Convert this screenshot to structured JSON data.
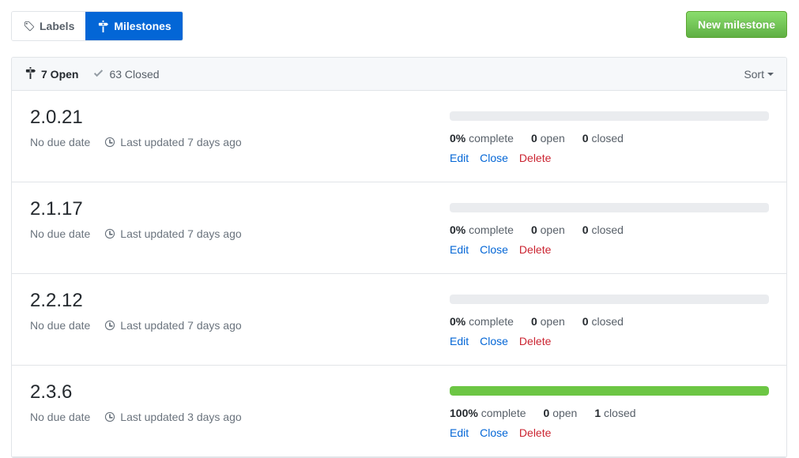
{
  "tabs": [
    {
      "label": "Labels",
      "icon": "tag-icon",
      "active": false
    },
    {
      "label": "Milestones",
      "icon": "milestone-icon",
      "active": true
    }
  ],
  "new_milestone_button": "New milestone",
  "list_header": {
    "open_state": "7 Open",
    "closed_state": "63 Closed",
    "open_icon": "milestone-icon",
    "closed_icon": "check-icon",
    "sort_label": "Sort"
  },
  "action_labels": {
    "edit": "Edit",
    "close": "Close",
    "delete": "Delete"
  },
  "stat_labels": {
    "complete": "complete",
    "open": "open",
    "closed": "closed"
  },
  "colors": {
    "accent_blue": "#0366d6",
    "progress_green": "#6cc644",
    "button_green": "#60b044",
    "delete_red": "#cb2431",
    "progress_track": "#eaecef",
    "border": "#e1e4e8",
    "header_bg": "#f6f8fa"
  },
  "milestones": [
    {
      "title": "2.0.21",
      "due": "No due date",
      "updated": "Last updated 7 days ago",
      "percent_label": "0%",
      "percent_value": 0,
      "open_count": "0",
      "closed_count": "0"
    },
    {
      "title": "2.1.17",
      "due": "No due date",
      "updated": "Last updated 7 days ago",
      "percent_label": "0%",
      "percent_value": 0,
      "open_count": "0",
      "closed_count": "0"
    },
    {
      "title": "2.2.12",
      "due": "No due date",
      "updated": "Last updated 7 days ago",
      "percent_label": "0%",
      "percent_value": 0,
      "open_count": "0",
      "closed_count": "0"
    },
    {
      "title": "2.3.6",
      "due": "No due date",
      "updated": "Last updated 3 days ago",
      "percent_label": "100%",
      "percent_value": 100,
      "open_count": "0",
      "closed_count": "1"
    }
  ]
}
